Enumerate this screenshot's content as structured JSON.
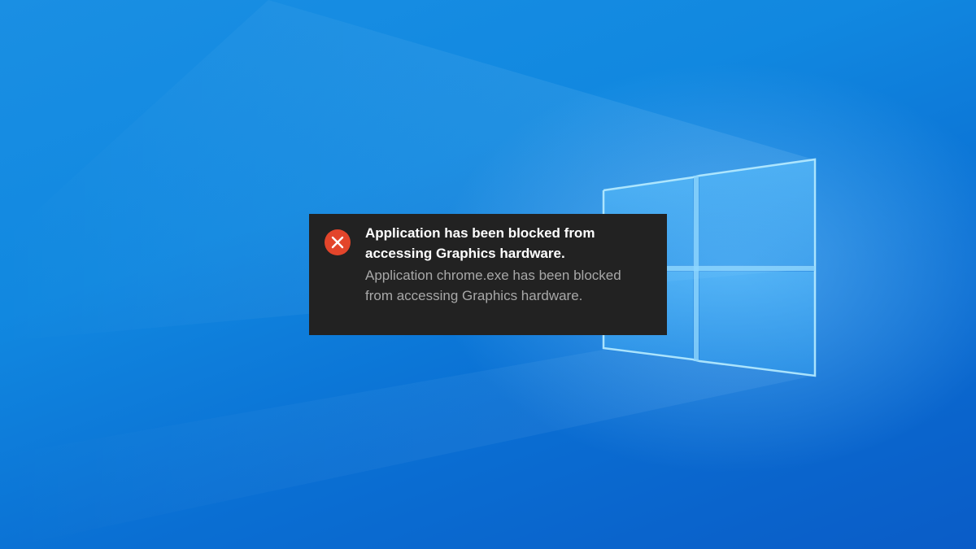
{
  "desktop": {
    "wallpaper": "windows-10-hero-logo",
    "colors": {
      "background_light": "#1a8fe3",
      "background_dark": "#0a5cc7",
      "logo_glow": "#9fdcff"
    }
  },
  "toast": {
    "icon": "error-x-icon",
    "icon_color": "#e3452b",
    "background_color": "#222222",
    "title": "Application has been blocked from accessing Graphics hardware.",
    "body": "Application chrome.exe has been blocked from accessing Graphics hardware."
  }
}
